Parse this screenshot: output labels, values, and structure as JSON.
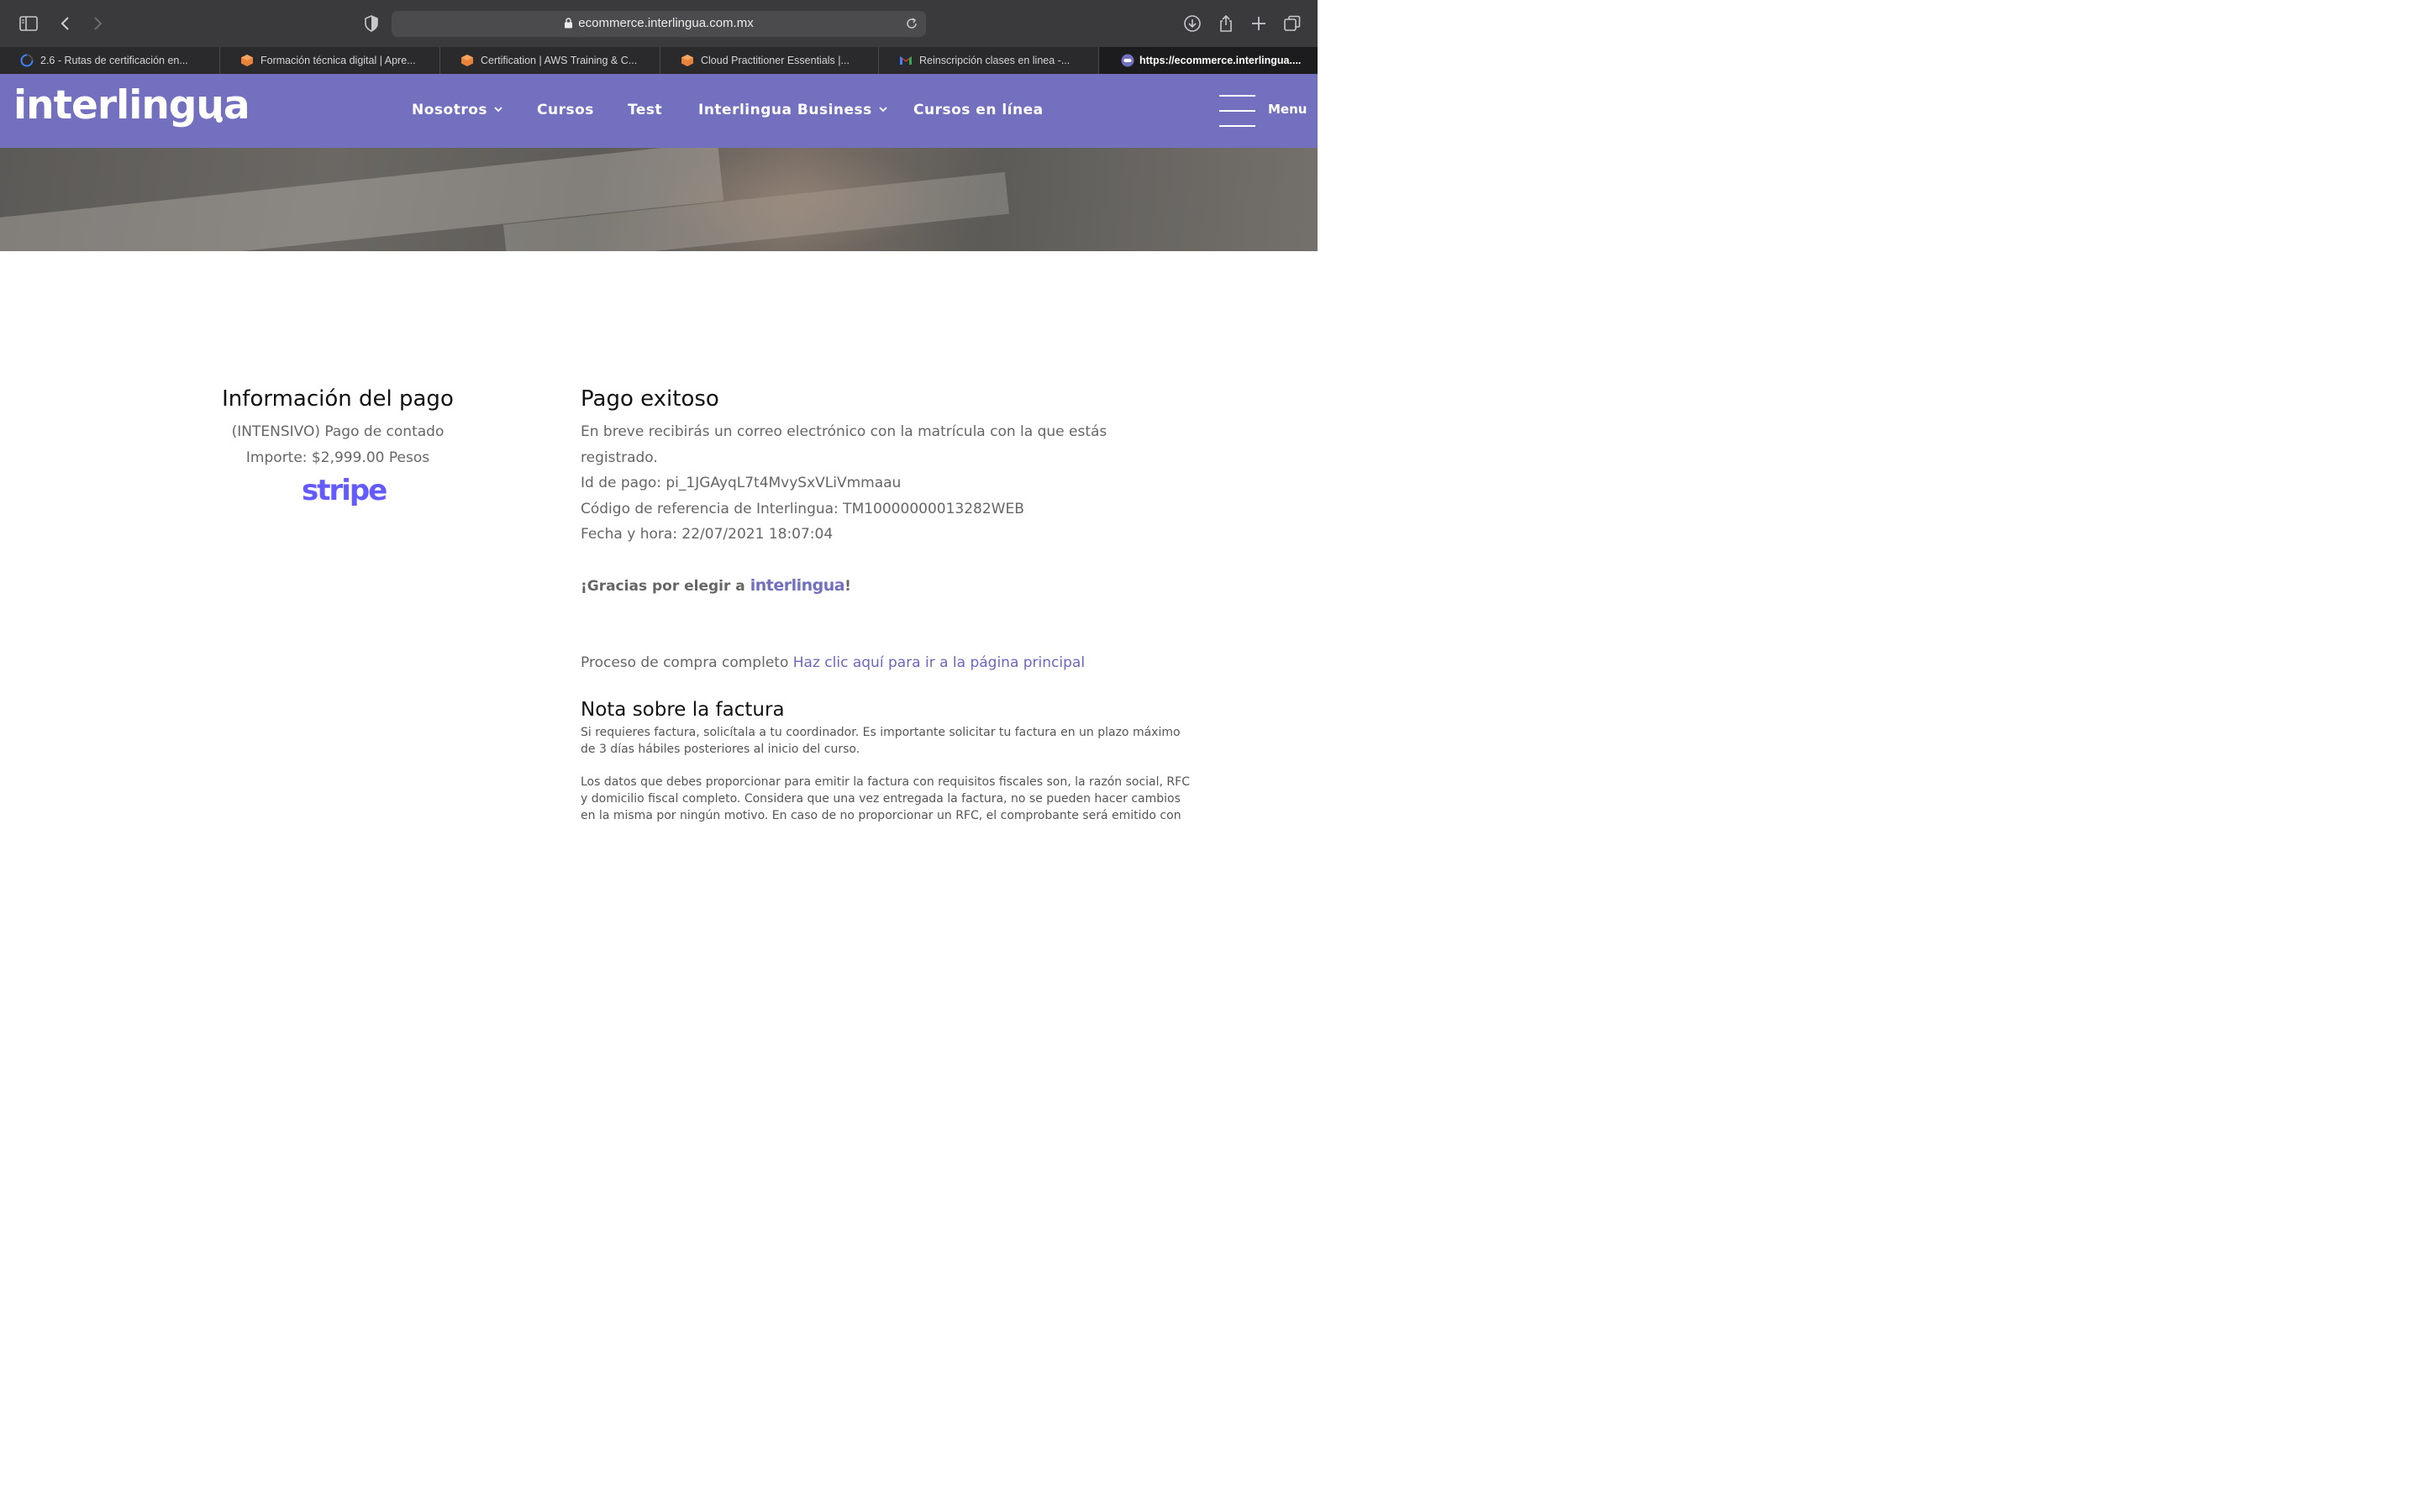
{
  "browser": {
    "url": "ecommerce.interlingua.com.mx",
    "tabs": [
      {
        "label": "2.6 - Rutas de certificación en...",
        "icon": "loading-spinner-icon"
      },
      {
        "label": "Formación técnica digital | Apre...",
        "icon": "aws-cube-icon"
      },
      {
        "label": "Certification | AWS Training & C...",
        "icon": "aws-cube-icon"
      },
      {
        "label": "Cloud Practitioner Essentials |...",
        "icon": "aws-cube-icon"
      },
      {
        "label": "Reinscripción clases en linea -...",
        "icon": "gmail-icon"
      },
      {
        "label": "https://ecommerce.interlingua....",
        "icon": "site-favicon-icon"
      }
    ],
    "active_tab_index": 5
  },
  "nav": {
    "logo": "interlingua",
    "items": [
      {
        "label": "Nosotros",
        "has_dropdown": true
      },
      {
        "label": "Cursos",
        "has_dropdown": false
      },
      {
        "label": "Test",
        "has_dropdown": false
      },
      {
        "label": "Interlingua Business",
        "has_dropdown": true
      },
      {
        "label": "Cursos en línea",
        "has_dropdown": false
      }
    ],
    "menu_label": "Menu"
  },
  "payment_info": {
    "title": "Información del pago",
    "product": "(INTENSIVO) Pago de contado",
    "amount": "Importe: $2,999.00 Pesos",
    "provider_logo": "stripe"
  },
  "success": {
    "title": "Pago exitoso",
    "message_line1": "En breve recibirás un correo electrónico con la matrícula con la que estás",
    "message_line2": "registrado.",
    "payment_id": "Id de pago: pi_1JGAyqL7t4MvySxVLiVmmaau",
    "reference_code": "Código de referencia de Interlingua: TM10000000013282WEB",
    "datetime": "Fecha y hora: 22/07/2021 18:07:04",
    "thanks_prefix": "¡Gracias por elegir a ",
    "thanks_brand": "interlingua",
    "thanks_suffix": "!",
    "complete_text": "Proceso de compra completo ",
    "home_link": "Haz clic aquí para ir a la página principal"
  },
  "invoice_note": {
    "title": "Nota sobre la factura",
    "para1": "Si requieres factura, solicítala a tu coordinador. Es importante solicitar tu factura en un plazo máximo de 3 días hábiles posteriores al inicio del curso.",
    "para2": "Los datos que debes proporcionar para emitir la factura con requisitos fiscales son, la razón social, RFC y domicilio fiscal completo. Considera que una vez entregada la factura, no se pueden hacer cambios en la misma por ningún motivo. En caso de no proporcionar un RFC, el comprobante será emitido con"
  },
  "colors": {
    "brand_purple": "#7370bf",
    "stripe_purple": "#635bff",
    "toolbar": "#3a3a3c"
  }
}
